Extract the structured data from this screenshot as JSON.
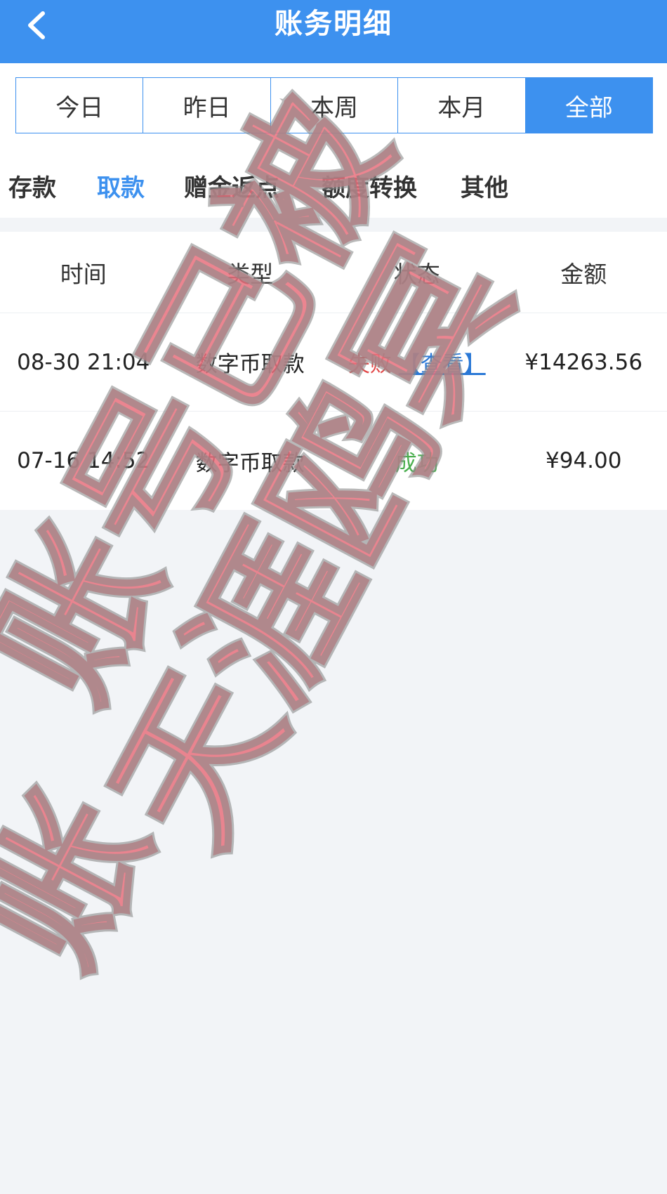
{
  "header": {
    "title": "账务明细",
    "back_icon": "chevron-left-icon",
    "background": "#3d91ef"
  },
  "period_tabs": [
    {
      "label": "今日",
      "active": false
    },
    {
      "label": "昨日",
      "active": false
    },
    {
      "label": "本周",
      "active": false
    },
    {
      "label": "本月",
      "active": false
    },
    {
      "label": "全部",
      "active": true
    }
  ],
  "category_tabs": [
    {
      "label": "存款",
      "active": false
    },
    {
      "label": "取款",
      "active": true
    },
    {
      "label": "赠金返点",
      "active": false
    },
    {
      "label": "额度转换",
      "active": false
    },
    {
      "label": "其他",
      "active": false
    }
  ],
  "table": {
    "columns": [
      "时间",
      "类型",
      "状态",
      "金额"
    ],
    "rows": [
      {
        "time": "08-30 21:04",
        "type": "数字币取款",
        "status": "失败",
        "status_color": "#e24a4a",
        "link": "【查看】",
        "amount": "¥14263.56"
      },
      {
        "time": "07-16 14:52",
        "type": "数字币取款",
        "status": "成功",
        "status_color": "#4caf50",
        "link": "",
        "amount": "¥94.00"
      }
    ]
  },
  "colors": {
    "accent": "#3d91ef",
    "fail": "#e24a4a",
    "success": "#4caf50",
    "watermark": "#e8707c"
  },
  "watermark": {
    "lines": [
      "账号已被",
      "天涯鸥冥",
      "账"
    ]
  }
}
